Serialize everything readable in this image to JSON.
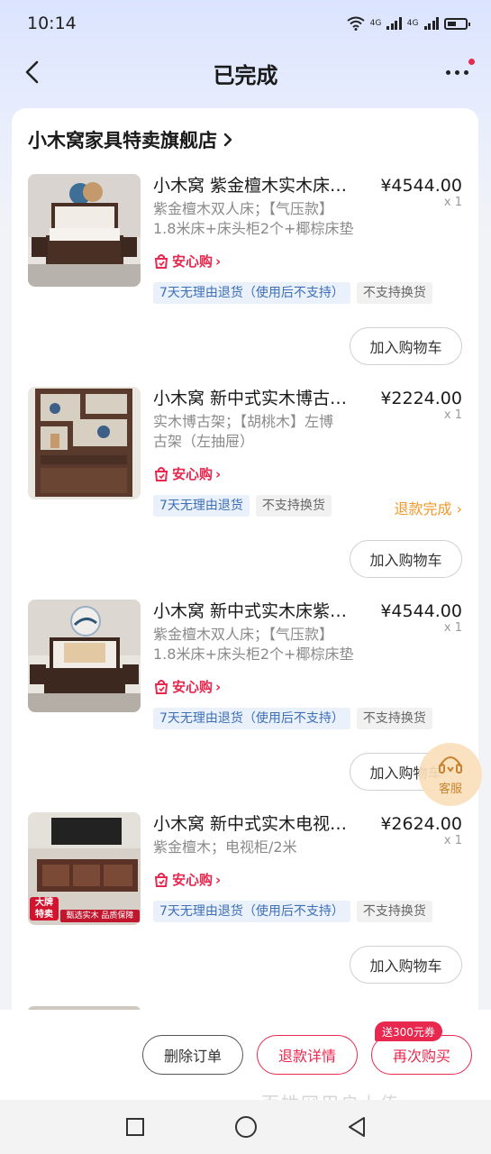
{
  "status_bar": {
    "time": "10:14",
    "network_1": "4G",
    "network_2": "4G"
  },
  "nav": {
    "title": "已完成"
  },
  "store": {
    "name": "小木窝家具特卖旗舰店"
  },
  "items": [
    {
      "title": "小木窝 紫金檀木实木床…",
      "price": "¥4544.00",
      "qty": "x 1",
      "spec_1": "紫金檀木双人床；【气压款】",
      "spec_2": "1.8米床+床头柜2个+椰棕床垫",
      "assure": "安心购",
      "tags": [
        "7天无理由退货（使用后不支持）",
        "不支持换货"
      ],
      "refund_status": "",
      "cart_button": "加入购物车"
    },
    {
      "title": "小木窝 新中式实木博古…",
      "price": "¥2224.00",
      "qty": "x 1",
      "spec_1": "实木博古架；【胡桃木】左博",
      "spec_2": "古架（左抽屉）",
      "assure": "安心购",
      "tags": [
        "7天无理由退货",
        "不支持换货"
      ],
      "refund_status": "退款完成",
      "cart_button": "加入购物车"
    },
    {
      "title": "小木窝 新中式实木床紫…",
      "price": "¥4544.00",
      "qty": "x 1",
      "spec_1": "紫金檀木双人床；【气压款】",
      "spec_2": "1.8米床+床头柜2个+椰棕床垫",
      "assure": "安心购",
      "tags": [
        "7天无理由退货（使用后不支持）",
        "不支持换货"
      ],
      "refund_status": "",
      "cart_button": "加入购物车"
    },
    {
      "title": "小木窝 新中式实木电视…",
      "price": "¥2624.00",
      "qty": "x 1",
      "spec_1": "紫金檀木；电视柜/2米",
      "spec_2": "",
      "assure": "安心购",
      "tags": [
        "7天无理由退货（使用后不支持）",
        "不支持换货"
      ],
      "refund_status": "",
      "cart_button": "加入购物车",
      "thumb_badge_1": "大牌",
      "thumb_badge_2": "特卖",
      "thumb_banner": "甄选实木 品质保障"
    }
  ],
  "customer_service": {
    "label": "客服"
  },
  "bottom": {
    "delete": "删除订单",
    "refund_detail": "退款详情",
    "rebuy": "再次购买",
    "coupon": "送300元券",
    "watermark": "百姓网用户上传"
  },
  "colors": {
    "accent": "#e8284e",
    "refund": "#f0982b",
    "tag_blue": "#3d6fb6"
  }
}
